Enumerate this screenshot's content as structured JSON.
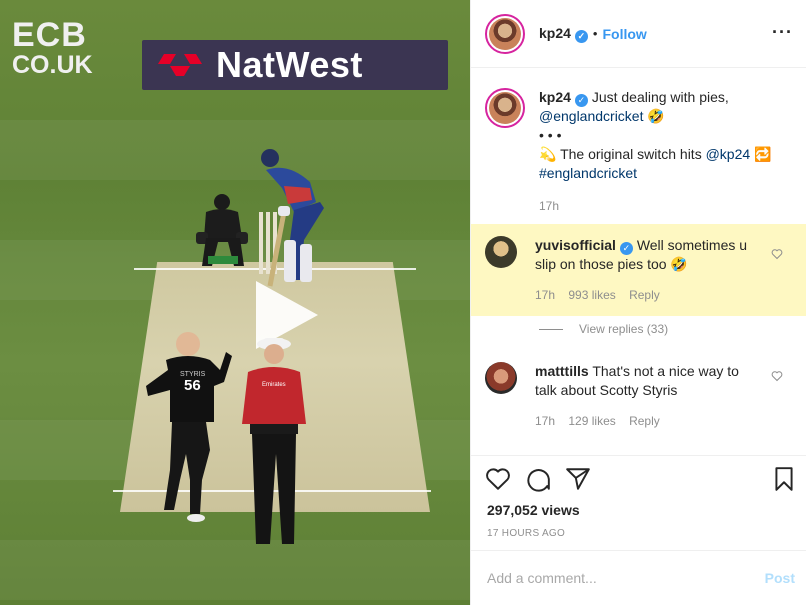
{
  "video": {
    "broadcaster_logo_line1": "ECB",
    "broadcaster_logo_line2": "CO.UK",
    "sponsor_board": "NatWest",
    "bowler_shirt_number": "56",
    "bowler_shirt_name": "STYRIS",
    "umpire_badge": "Emirates",
    "play_icon": "play-icon"
  },
  "header": {
    "username": "kp24",
    "separator": "•",
    "follow_label": "Follow",
    "more_icon": "more-options-icon",
    "more_label": "···"
  },
  "caption": {
    "username": "kp24",
    "line1": "Just dealing with pies,",
    "mention": "@englandcricket",
    "emoji": "🤣",
    "dots": "• • •",
    "line2_emoji": "💫",
    "line2_text": "The original switch hits",
    "line2_mention": "@kp24",
    "line2_tail": "🔁",
    "hashtag": "#englandcricket",
    "time": "17h"
  },
  "comments": [
    {
      "username": "yuvisofficial",
      "verified": true,
      "text": "Well sometimes u slip on those pies too",
      "emoji": "🤣",
      "time": "17h",
      "likes": "993 likes",
      "reply": "Reply",
      "highlight_color": "#fef8c2"
    },
    {
      "username": "matttills",
      "verified": false,
      "text": "That's not a nice way to talk about Scotty Styris",
      "time": "17h",
      "likes": "129 likes",
      "reply": "Reply"
    }
  ],
  "view_replies": "View replies (33)",
  "actions": {
    "like_icon": "heart-icon",
    "comment_icon": "comment-icon",
    "share_icon": "share-icon",
    "save_icon": "bookmark-icon"
  },
  "views": "297,052 views",
  "posted_ago": "17 HOURS AGO",
  "add_comment": {
    "placeholder": "Add a comment...",
    "post_label": "Post"
  },
  "colors": {
    "link": "#00376b",
    "follow": "#3897f0",
    "verified": "#3897f0",
    "post_disabled": "#b2dffc"
  }
}
